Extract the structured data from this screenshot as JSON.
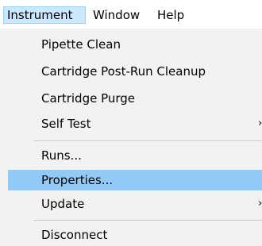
{
  "menubar": {
    "items": [
      {
        "label": "Instrument"
      },
      {
        "label": "Window"
      },
      {
        "label": "Help"
      }
    ]
  },
  "dropdown": {
    "items": [
      {
        "label": "Pipette Clean"
      },
      {
        "label": "Cartridge Post-Run Cleanup"
      },
      {
        "label": "Cartridge Purge"
      },
      {
        "label": "Self Test",
        "arrow": "›"
      },
      {
        "label": "Runs..."
      },
      {
        "label": "Properties..."
      },
      {
        "label": "Update",
        "arrow": "›"
      },
      {
        "label": "Disconnect"
      }
    ]
  },
  "colors": {
    "highlight": "#91c9f7",
    "menubar_active": "#cce8ff",
    "dropdown_bg": "#f2f2f2"
  }
}
